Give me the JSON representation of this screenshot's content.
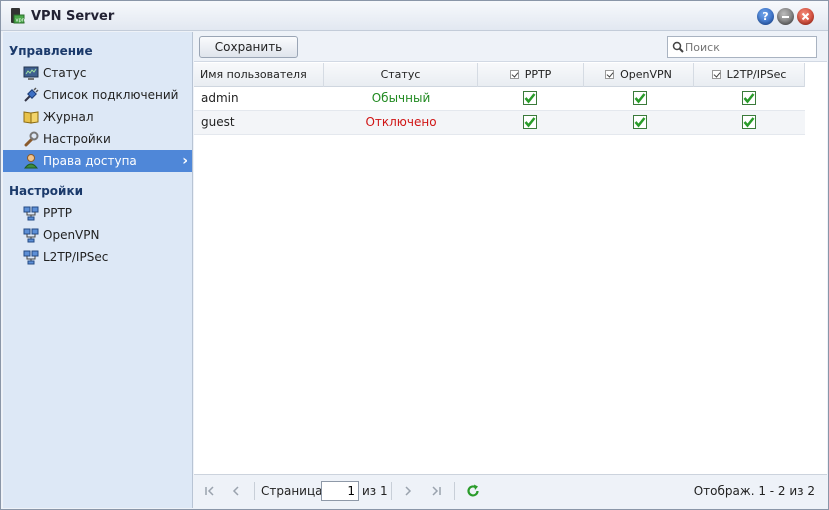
{
  "window": {
    "title": "VPN Server",
    "help_label": "?"
  },
  "sidebar": {
    "management_title": "Управление",
    "management_items": [
      {
        "label": "Статус",
        "icon": "monitor-icon"
      },
      {
        "label": "Список подключений",
        "icon": "plug-icon"
      },
      {
        "label": "Журнал",
        "icon": "book-icon"
      },
      {
        "label": "Настройки",
        "icon": "wrench-icon"
      },
      {
        "label": "Права доступа",
        "icon": "user-icon",
        "active": true
      }
    ],
    "settings_title": "Настройки",
    "settings_items": [
      {
        "label": "PPTP",
        "icon": "network-icon"
      },
      {
        "label": "OpenVPN",
        "icon": "network-icon"
      },
      {
        "label": "L2TP/IPSec",
        "icon": "network-icon"
      }
    ]
  },
  "toolbar": {
    "save_label": "Сохранить",
    "search_placeholder": "Поиск"
  },
  "table": {
    "columns": [
      "Имя пользователя",
      "Статус",
      "PPTP",
      "OpenVPN",
      "L2TP/IPSec"
    ],
    "rows": [
      {
        "user": "admin",
        "status": "Обычный",
        "pptp": true,
        "openvpn": true,
        "l2tp": true
      },
      {
        "user": "guest",
        "status": "Отключено",
        "pptp": true,
        "openvpn": true,
        "l2tp": true
      }
    ]
  },
  "pager": {
    "page_label": "Страница",
    "page_value": "1",
    "of_label": "из 1",
    "display_info": "Отображ. 1 - 2 из 2"
  },
  "colors": {
    "accent": "#4f87d8",
    "status_normal": "#218a21",
    "status_disabled": "#d01515",
    "check": "#2a9c2a"
  }
}
